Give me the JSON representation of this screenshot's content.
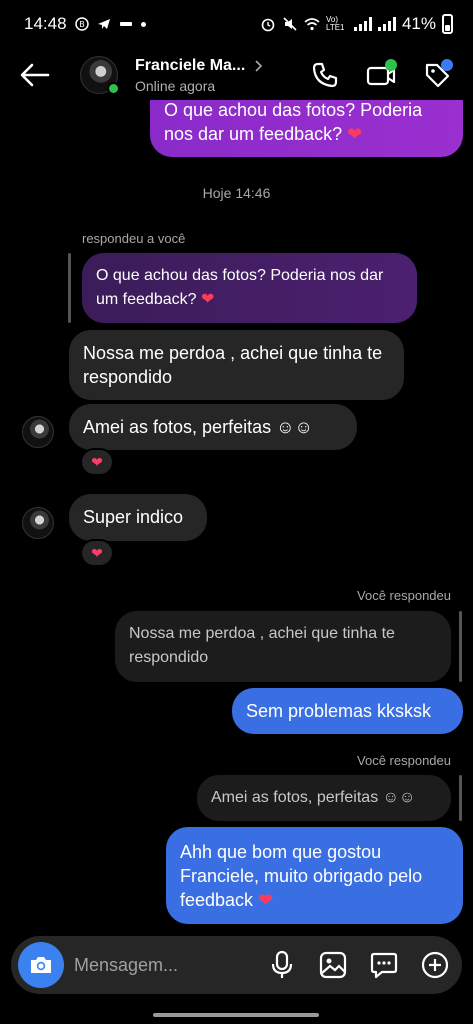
{
  "status_bar": {
    "time": "14:48",
    "battery": "41%",
    "network": "Vo) LTE1"
  },
  "header": {
    "contact_name": "Franciele Ma...",
    "presence": "Online agora",
    "icons": [
      "back-arrow-icon",
      "phone-icon",
      "video-icon",
      "tag-icon"
    ],
    "online_color": "#2fc24a"
  },
  "messages": {
    "top_outgoing": "O que achou das fotos? Poderia nos dar um feedback?",
    "date_divider": "Hoje 14:46",
    "reply_label": "respondeu a você",
    "quoted_text": "O que achou das fotos? Poderia nos dar um feedback?",
    "in_1": "Nossa me perdoa , achei que tinha te respondido",
    "in_2": "Amei as fotos, perfeitas ☺☺",
    "in_3": "Super indico",
    "you_replied_1": "Você respondeu",
    "quoted_out_1": "Nossa me perdoa , achei que tinha te respondido",
    "out_1": "Sem problemas kksksk",
    "you_replied_2": "Você respondeu",
    "quoted_out_2": "Amei as fotos, perfeitas ☺☺",
    "out_2": "Ahh que bom que gostou Franciele, muito obrigado pelo feedback",
    "heart": "❤",
    "reaction": "❤"
  },
  "composer": {
    "placeholder": "Mensagem...",
    "icons": [
      "camera-icon",
      "mic-icon",
      "gallery-icon",
      "sticker-icon",
      "plus-icon"
    ]
  },
  "colors": {
    "outgoing_blue": "#3a6fe3",
    "outgoing_purple": "#9b2fd0",
    "incoming": "#262626",
    "camera_button": "#3b82f0"
  }
}
